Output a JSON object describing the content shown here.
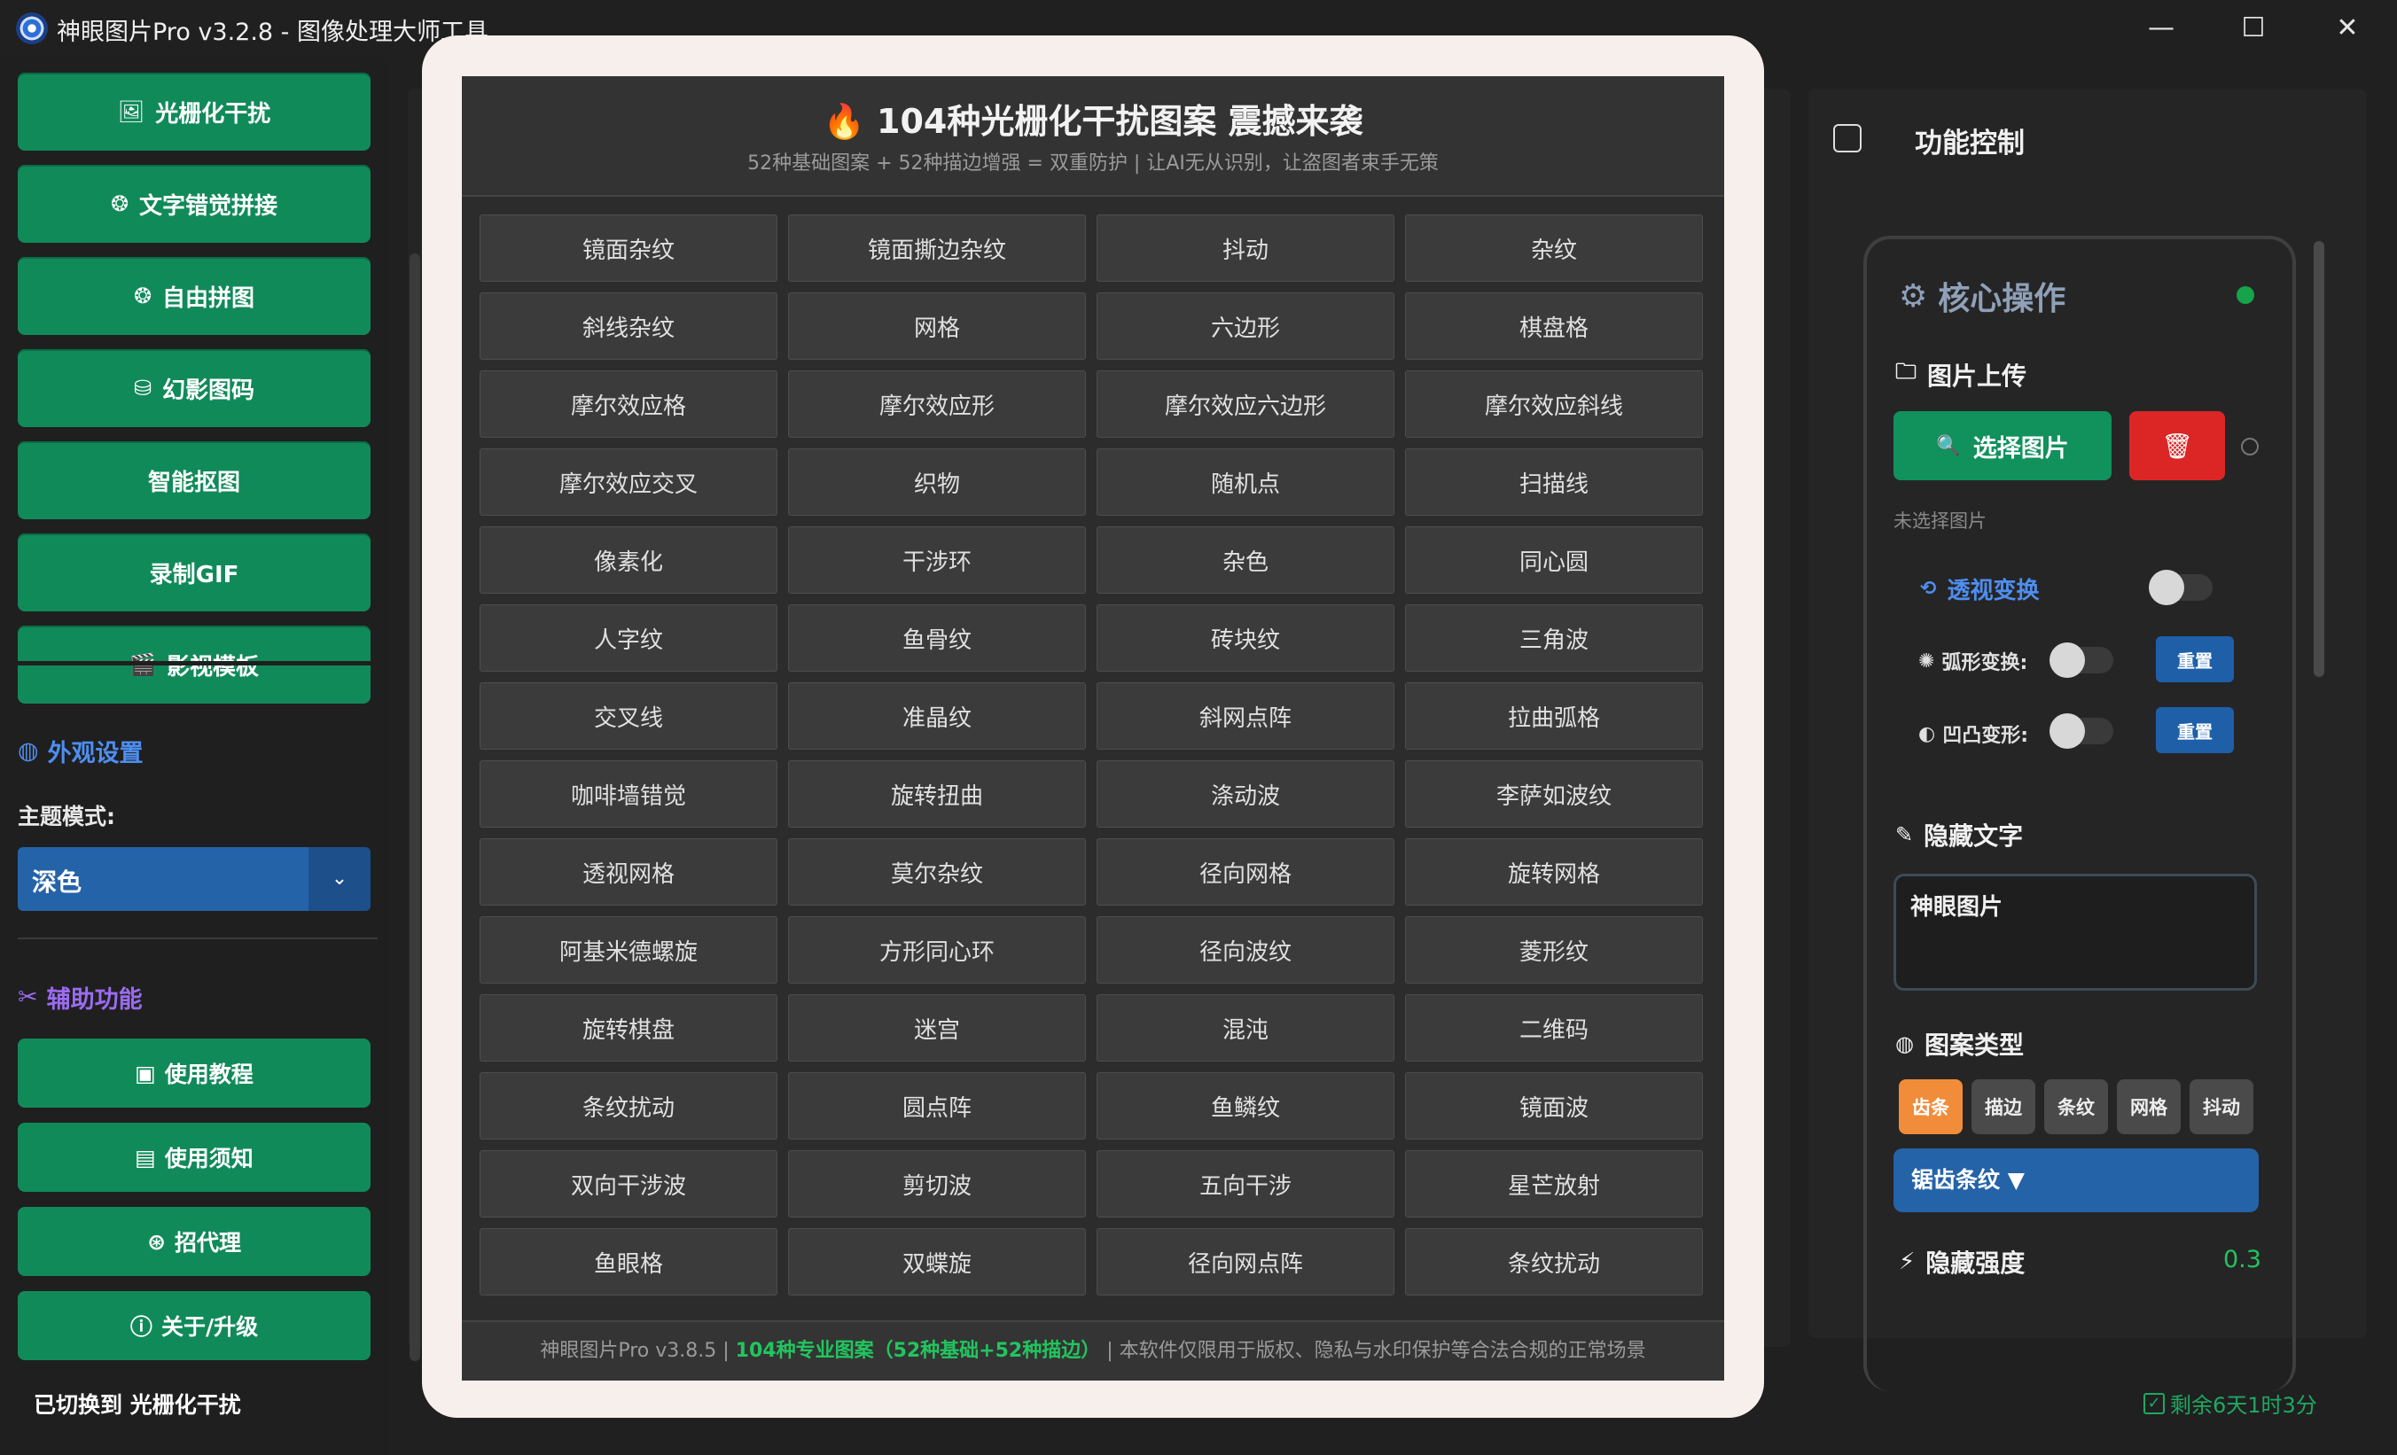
{
  "window": {
    "title": "神眼图片Pro v3.2.8 - 图像处理大师工具",
    "controls": {
      "minimize": "—",
      "maximize": "☐",
      "close": "✕"
    }
  },
  "sidebar": {
    "nav": [
      {
        "icon": "🖼",
        "label": "光栅化干扰"
      },
      {
        "icon": "❂",
        "label": "文字错觉拼接"
      },
      {
        "icon": "❂",
        "label": "自由拼图"
      },
      {
        "icon": "⛁",
        "label": "幻影图码"
      },
      {
        "icon": "",
        "label": "智能抠图"
      },
      {
        "icon": "",
        "label": "录制GIF"
      },
      {
        "icon": "🎬",
        "label": "影视模板"
      }
    ],
    "appearance": {
      "heading": "外观设置",
      "theme_label": "主题模式:",
      "theme_value": "深色",
      "arrow": "⌄"
    },
    "aux": {
      "heading": "辅助功能",
      "buttons": [
        {
          "icon": "▣",
          "label": "使用教程"
        },
        {
          "icon": "▤",
          "label": "使用须知"
        },
        {
          "icon": "⊛",
          "label": "招代理"
        },
        {
          "icon": "ⓘ",
          "label": "关于/升级"
        }
      ]
    },
    "status": "已切换到 光栅化干扰"
  },
  "modal": {
    "title_icon": "🔥",
    "title": "104种光栅化干扰图案 震撼来袭",
    "subtitle": "52种基础图案 + 52种描边增强 = 双重防护 | 让AI无从识别，让盗图者束手无策",
    "patterns": [
      "镜面杂纹",
      "镜面撕边杂纹",
      "抖动",
      "杂纹",
      "斜线杂纹",
      "网格",
      "六边形",
      "棋盘格",
      "摩尔效应格",
      "摩尔效应形",
      "摩尔效应六边形",
      "摩尔效应斜线",
      "摩尔效应交叉",
      "织物",
      "随机点",
      "扫描线",
      "像素化",
      "干涉环",
      "杂色",
      "同心圆",
      "人字纹",
      "鱼骨纹",
      "砖块纹",
      "三角波",
      "交叉线",
      "准晶纹",
      "斜网点阵",
      "拉曲弧格",
      "咖啡墙错觉",
      "旋转扭曲",
      "涤动波",
      "李萨如波纹",
      "透视网格",
      "莫尔杂纹",
      "径向网格",
      "旋转网格",
      "阿基米德螺旋",
      "方形同心环",
      "径向波纹",
      "菱形纹",
      "旋转棋盘",
      "迷宫",
      "混沌",
      "二维码",
      "条纹扰动",
      "圆点阵",
      "鱼鳞纹",
      "镜面波",
      "双向干涉波",
      "剪切波",
      "五向干涉",
      "星芒放射",
      "鱼眼格",
      "双蝶旋",
      "径向网点阵",
      "条纹扰动"
    ],
    "footer": {
      "prefix": "神眼图片Pro v3.8.5 | ",
      "highlight": "104种专业图案（52种基础+52种描边）",
      "suffix": " | 本软件仅限用于版权、隐私与水印保护等合法合规的正常场景"
    }
  },
  "right_panel": {
    "title": "功能控制",
    "card_title": "核心操作",
    "card_icon": "⚙",
    "upload": {
      "label": "图片上传",
      "select_button": "选择图片",
      "select_icon": "🔍",
      "delete_icon": "🗑",
      "hint": "未选择图片"
    },
    "perspective": {
      "label": "透视变换",
      "icon": "⟲",
      "enabled": false
    },
    "arc": {
      "label": "弧形变换:",
      "icon": "✺",
      "enabled": false,
      "reset": "重置"
    },
    "bulge": {
      "label": "凹凸变形:",
      "icon": "◐",
      "enabled": false,
      "reset": "重置"
    },
    "hidden_text": {
      "label": "隐藏文字",
      "value": "神眼图片"
    },
    "pattern_type": {
      "label": "图案类型",
      "tabs": [
        "齿条",
        "描边",
        "条纹",
        "网格",
        "抖动"
      ],
      "active": "齿条",
      "selected": "锯齿条纹 ▼"
    },
    "strength": {
      "label": "隐藏强度",
      "icon": "⚡",
      "value": "0.3"
    }
  },
  "status_right": {
    "text": "剩余6天1时3分"
  },
  "colors": {
    "accent_green": "#118a5a",
    "accent_blue": "#2563a8",
    "danger_red": "#dc2626",
    "active_orange": "#f08c3a",
    "modal_frame": "#f7efec"
  }
}
